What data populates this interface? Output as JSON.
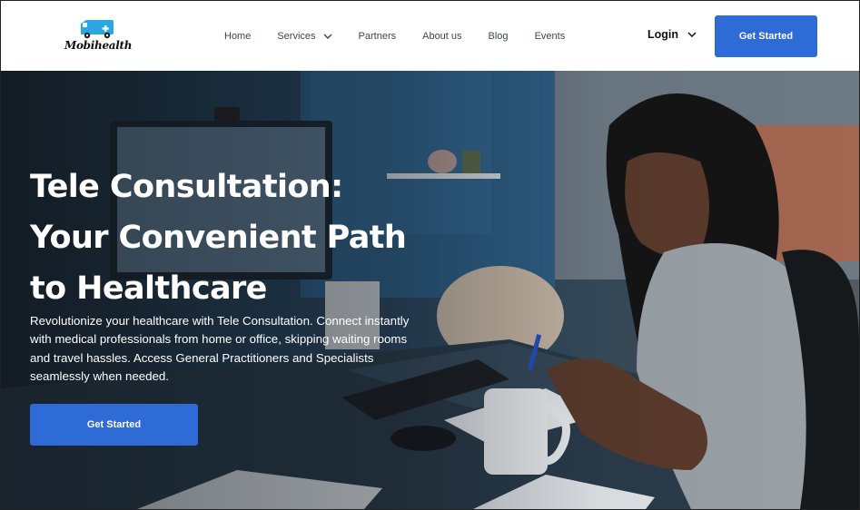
{
  "brand": {
    "name": "Mobihealth"
  },
  "nav": {
    "links": [
      {
        "label": "Home"
      },
      {
        "label": "Services"
      },
      {
        "label": "Partners"
      },
      {
        "label": "About us"
      },
      {
        "label": "Blog"
      },
      {
        "label": "Events"
      }
    ],
    "login_label": "Login",
    "cta_label": "Get Started"
  },
  "hero": {
    "title_lines": [
      "Tele Consultation:",
      "Your Convenient Path",
      "to Healthcare"
    ],
    "description": "Revolutionize your healthcare with Tele Consultation. Connect instantly with medical professionals from home or office, skipping waiting rooms and travel hassles. Access General Practitioners and Specialists seamlessly when needed.",
    "cta_label": "Get Started"
  },
  "colors": {
    "accent": "#2f6bd6",
    "text_dark": "#111111",
    "nav_text": "#3c4653"
  },
  "icons": [
    "ambulance-logo-icon",
    "chevron-down-icon"
  ]
}
